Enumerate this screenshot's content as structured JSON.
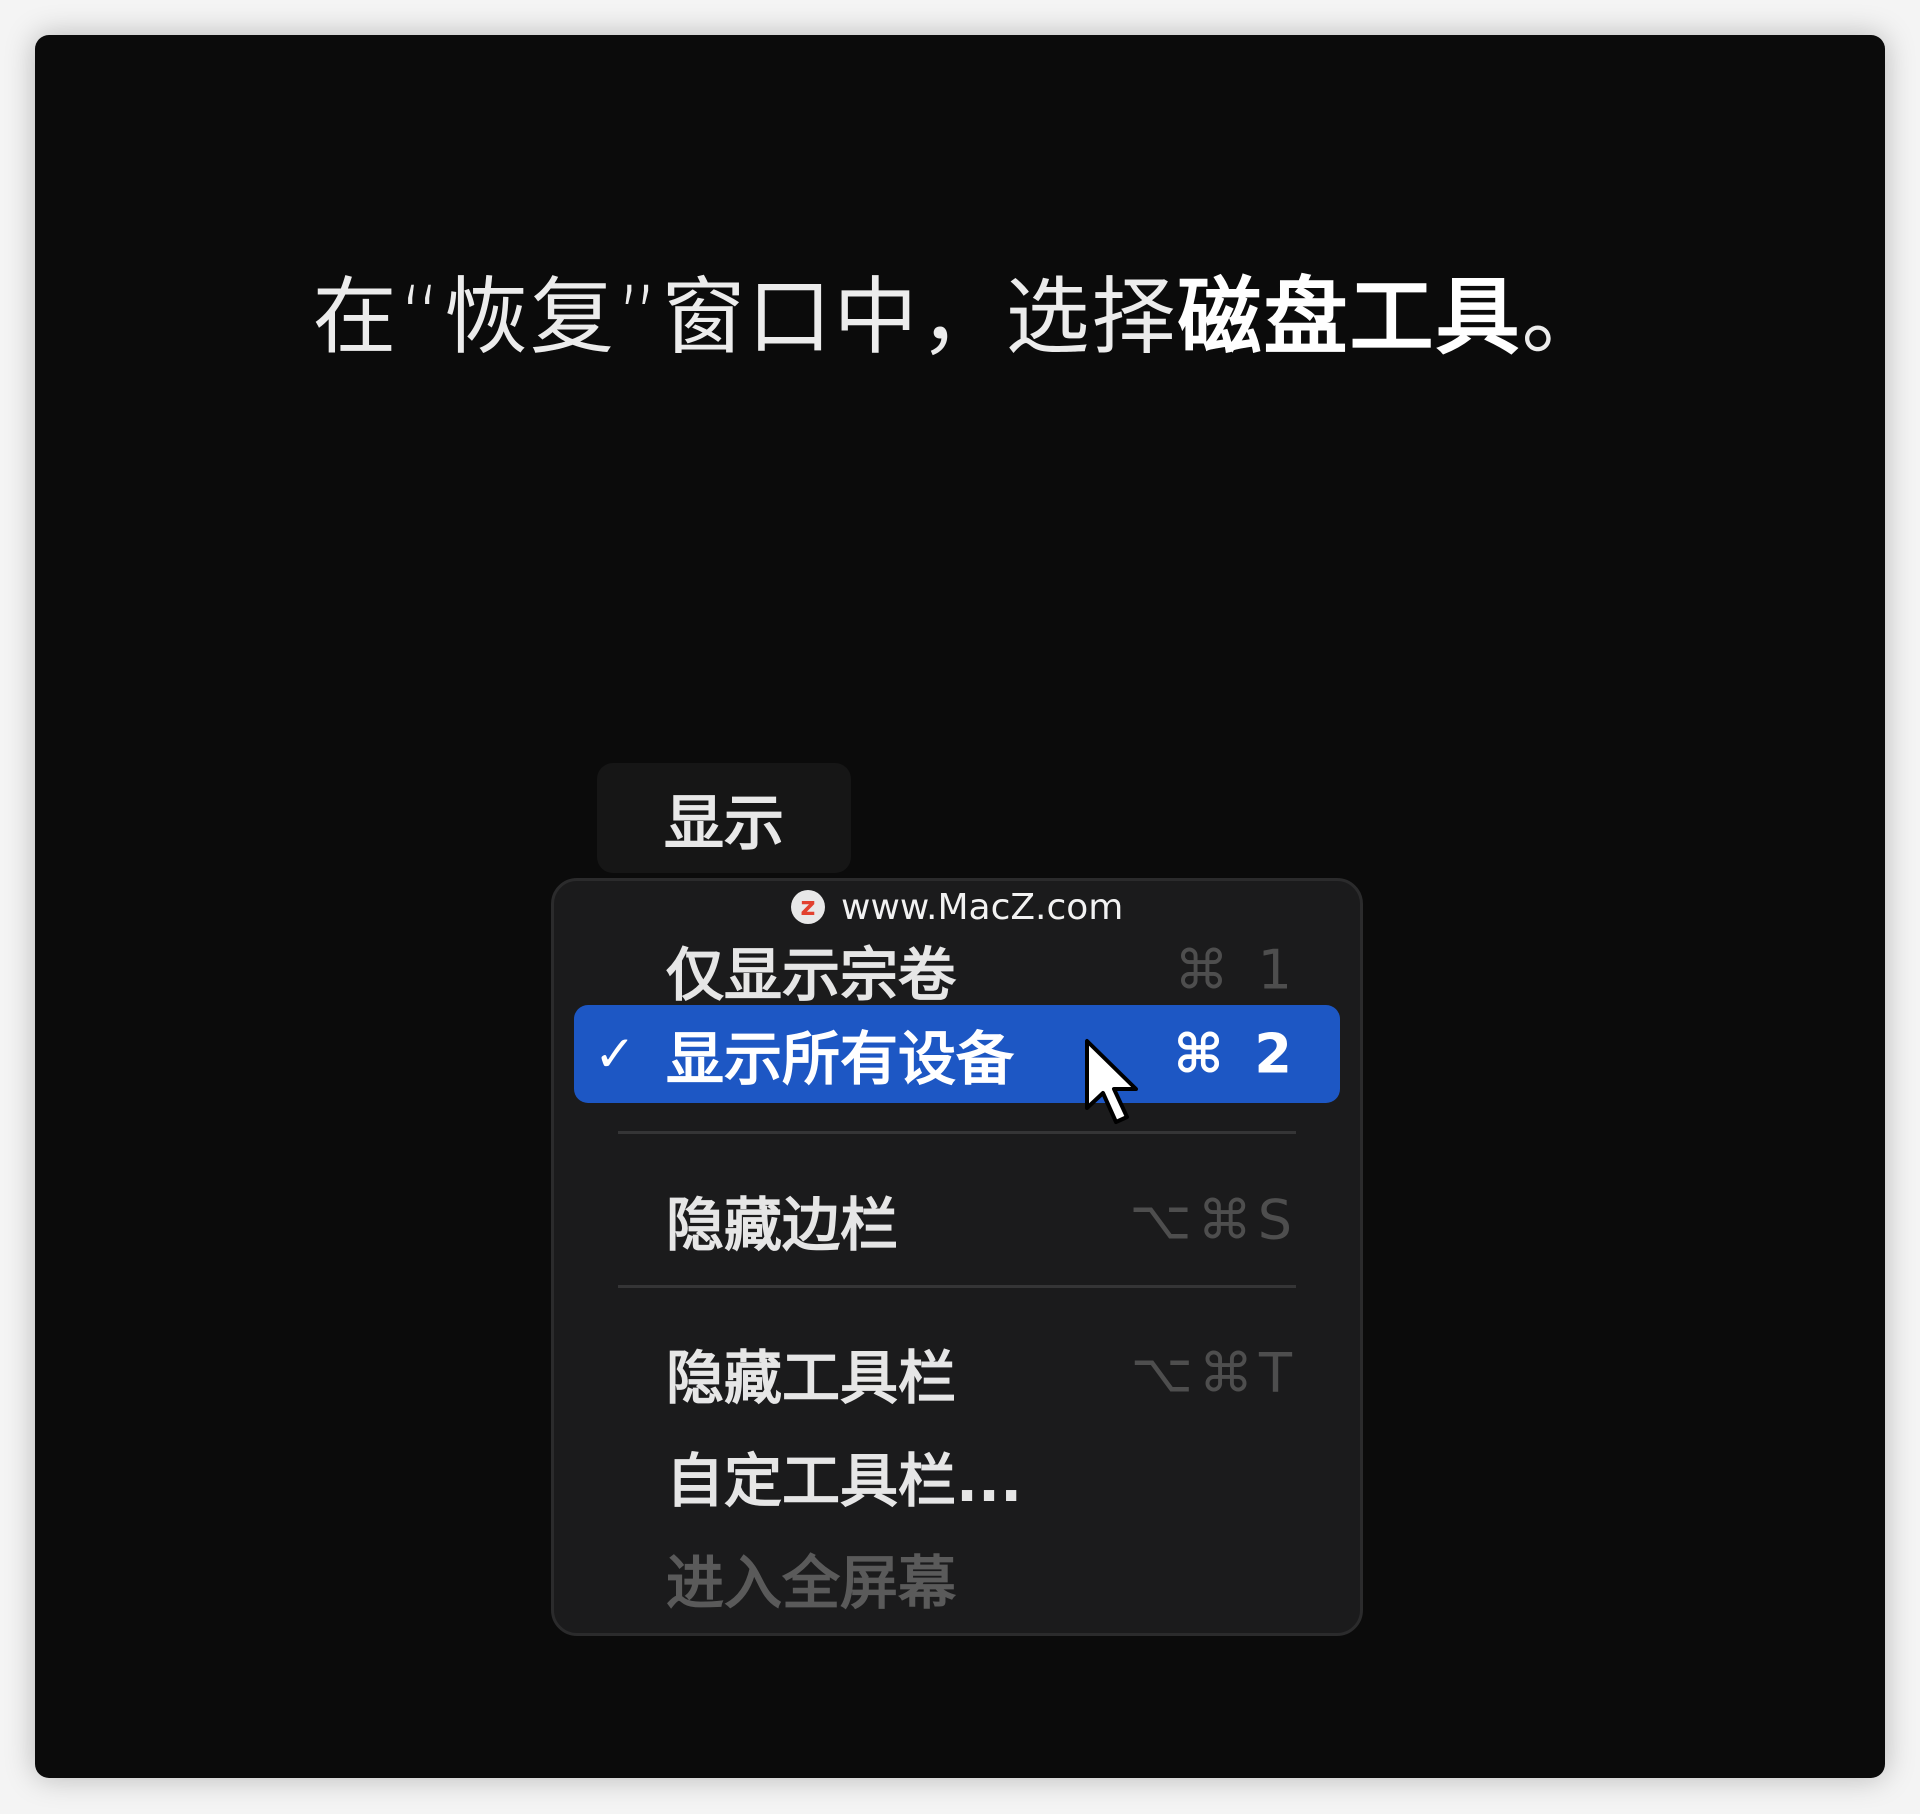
{
  "headline": {
    "prefix": "在“恢复”窗口中，选择",
    "bold": "磁盘工具",
    "suffix": "。"
  },
  "menubar": {
    "active_menu": "显示"
  },
  "menu": {
    "items": [
      {
        "label": "仅显示宗卷",
        "shortcut": "⌘ 1",
        "checked": false,
        "selected": false,
        "disabled": false
      },
      {
        "label": "显示所有设备",
        "shortcut": "⌘ 2",
        "checked": true,
        "check_mark": "✓",
        "selected": true,
        "disabled": false
      },
      {
        "label": "隐藏边栏",
        "shortcut": "⌥⌘S",
        "checked": false,
        "selected": false,
        "disabled": false
      },
      {
        "label": "隐藏工具栏",
        "shortcut": "⌥⌘T",
        "checked": false,
        "selected": false,
        "disabled": false
      },
      {
        "label": "自定工具栏...",
        "shortcut": "",
        "checked": false,
        "selected": false,
        "disabled": false
      },
      {
        "label": "进入全屏幕",
        "shortcut": "",
        "checked": false,
        "selected": false,
        "disabled": true
      }
    ]
  },
  "watermark": {
    "logo_letter": "z",
    "text": "www.MacZ.com"
  },
  "colors": {
    "background": "#0b0b0b",
    "menu_background": "#1b1b1c",
    "selection": "#1d57c4",
    "watermark_logo": "#e2412f"
  },
  "icons": {
    "cursor": "arrow-cursor-icon",
    "check": "checkmark-icon",
    "logo": "macz-logo-icon"
  }
}
